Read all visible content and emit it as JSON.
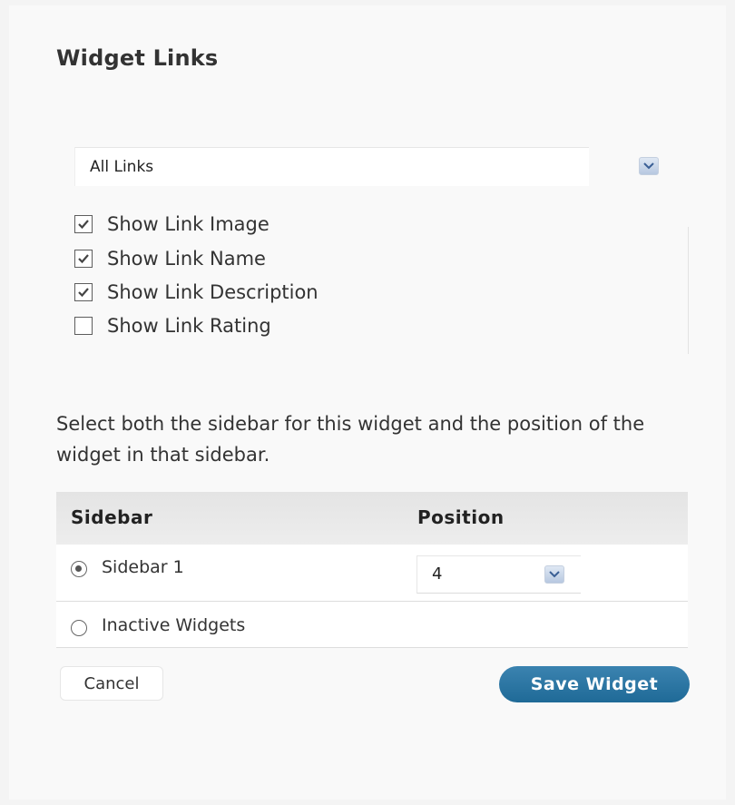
{
  "widget": {
    "title": "Widget Links"
  },
  "category_select": {
    "selected": "All Links"
  },
  "options": [
    {
      "label": "Show Link Image",
      "checked": true
    },
    {
      "label": "Show Link Name",
      "checked": true
    },
    {
      "label": "Show Link Description",
      "checked": true
    },
    {
      "label": "Show Link Rating",
      "checked": false
    }
  ],
  "instructions": "Select both the sidebar for this widget and the position of the widget in that sidebar.",
  "sidebar_table": {
    "headers": {
      "sidebar": "Sidebar",
      "position": "Position"
    },
    "rows": [
      {
        "label": "Sidebar 1",
        "selected": true,
        "position": "4"
      },
      {
        "label": "Inactive Widgets",
        "selected": false
      }
    ]
  },
  "actions": {
    "cancel_label": "Cancel",
    "save_label": "Save Widget"
  },
  "colors": {
    "save_button": "#2a76a4",
    "select_arrow": "#c9d6ea",
    "check_mark": "#444444"
  },
  "icons": {
    "dropdown": "chevron-down-icon",
    "checkbox": "checkbox-icon",
    "radio": "radio-icon"
  }
}
